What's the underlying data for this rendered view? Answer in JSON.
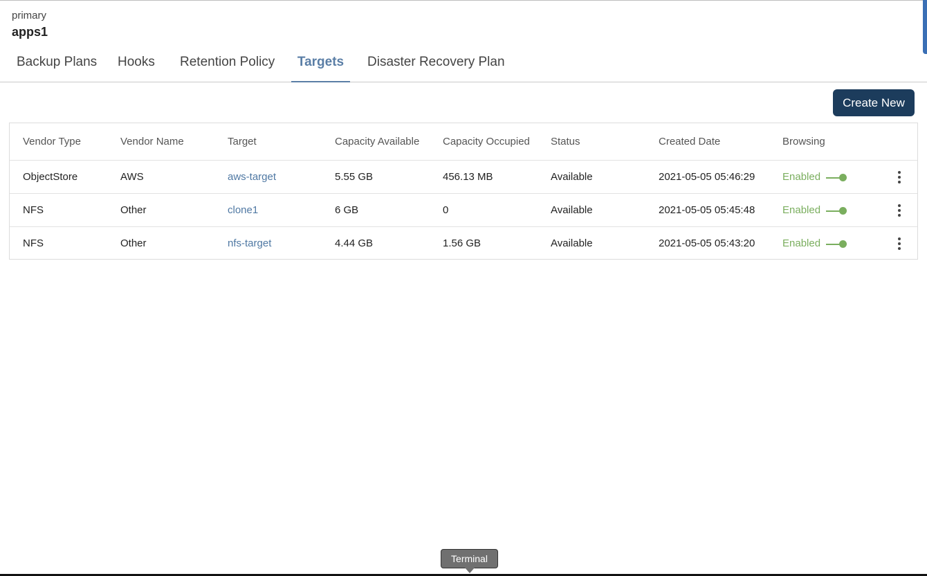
{
  "header": {
    "cluster": "primary",
    "namespace": "apps1"
  },
  "tabs": [
    "Backup Plans",
    "Hooks",
    "Retention Policy",
    "Targets",
    "Disaster Recovery Plan"
  ],
  "active_tab": "Targets",
  "create_button": "Create New",
  "table": {
    "columns": [
      "Vendor Type",
      "Vendor Name",
      "Target",
      "Capacity Available",
      "Capacity Occupied",
      "Status",
      "Created Date",
      "Browsing"
    ],
    "rows": [
      {
        "vendor_type": "ObjectStore",
        "vendor_name": "AWS",
        "target": "aws-target",
        "capacity_available": "5.55 GB",
        "capacity_occupied": "456.13 MB",
        "status": "Available",
        "created": "2021-05-05 05:46:29",
        "browsing": "Enabled"
      },
      {
        "vendor_type": "NFS",
        "vendor_name": "Other",
        "target": "clone1",
        "capacity_available": "6 GB",
        "capacity_occupied": "0",
        "status": "Available",
        "created": "2021-05-05 05:45:48",
        "browsing": "Enabled"
      },
      {
        "vendor_type": "NFS",
        "vendor_name": "Other",
        "target": "nfs-target",
        "capacity_available": "4.44 GB",
        "capacity_occupied": "1.56 GB",
        "status": "Available",
        "created": "2021-05-05 05:43:20",
        "browsing": "Enabled"
      }
    ]
  },
  "tooltip": "Terminal",
  "colors": {
    "accent": "#5a7ea6",
    "button": "#1c3c5c",
    "enabled": "#7aae5e"
  }
}
